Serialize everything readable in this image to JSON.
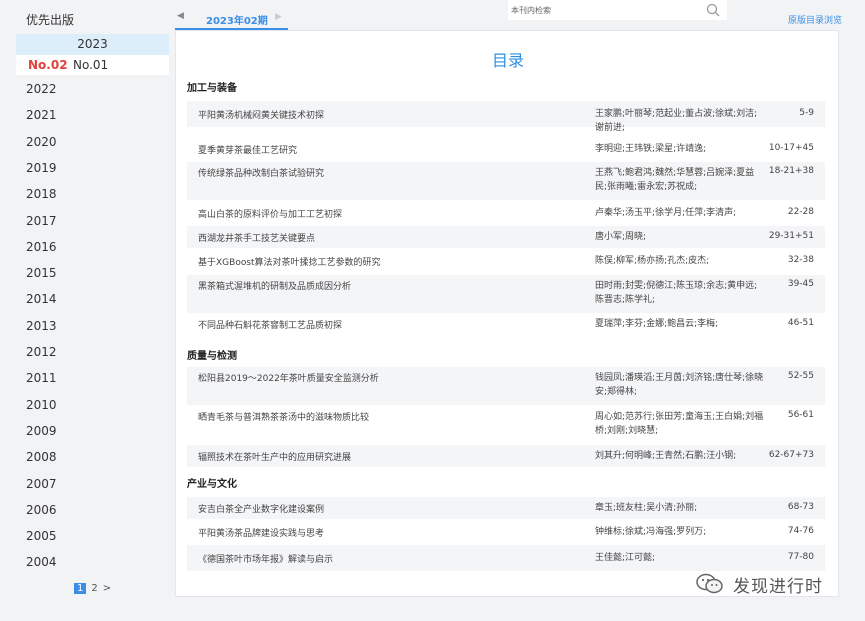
{
  "sidebar": {
    "heading": "优先出版",
    "current_year": "2023",
    "issues": [
      "No.02",
      "No.01"
    ],
    "years": [
      "2022",
      "2021",
      "2020",
      "2019",
      "2018",
      "2017",
      "2016",
      "2015",
      "2014",
      "2013",
      "2012",
      "2011",
      "2010",
      "2009",
      "2008",
      "2007",
      "2006",
      "2005",
      "2004"
    ],
    "pagination": {
      "current": "1",
      "next": "2",
      "arrow": ">"
    }
  },
  "issue_tab": {
    "prev": "◀",
    "label": "2023年02期",
    "next": "▶"
  },
  "search": {
    "placeholder": "本刊内检索",
    "icon": "search-icon"
  },
  "original_link": "原版目录浏览",
  "toc": {
    "title": "目录",
    "sections": [
      {
        "name": "加工与装备",
        "articles": [
          {
            "title": "平阳黄汤机械闷黄关键技术初探",
            "authors": "王家鹏;叶丽琴;范起业;董占波;徐斌;刘洁;谢前进;",
            "pages": "5-9"
          },
          {
            "title": "夏季黄芽茶最佳工艺研究",
            "authors": "李明迎;王玮铁;梁星;许靖逸;",
            "pages": "10-17+45"
          },
          {
            "title": "传统绿茶品种改制白茶试验研究",
            "authors": "王燕飞;鲍君鸿;魏然;华慧蓉;吕婉泽;夏益民;张雨曦;雷永宏;苏祝成;",
            "pages": "18-21+38"
          },
          {
            "title": "高山白茶的原料评价与加工工艺初探",
            "authors": "卢秦华;汤玉平;徐学月;任萍;李清声;",
            "pages": "22-28"
          },
          {
            "title": "西湖龙井茶手工技艺关键要点",
            "authors": "唐小军;周晓;",
            "pages": "29-31+51"
          },
          {
            "title": "基于XGBoost算法对茶叶揉捻工艺参数的研究",
            "authors": "陈俣;柳军;杨亦扬;孔杰;皮杰;",
            "pages": "32-38"
          },
          {
            "title": "黑茶箱式渥堆机的研制及品质成因分析",
            "authors": "田时雨;封雯;倪德江;陈玉琼;余志;黄申远;陈晋志;陈学礼;",
            "pages": "39-45"
          },
          {
            "title": "不同品种石斛花茶窨制工艺品质初探",
            "authors": "夏瑞萍;李芬;金娜;鲍昌云;李梅;",
            "pages": "46-51"
          }
        ]
      },
      {
        "name": "质量与检测",
        "articles": [
          {
            "title": "松阳县2019～2022年茶叶质量安全监测分析",
            "authors": "钱园凤;潘瑛滔;王月茵;刘济铭;唐仕琴;徐晓安;郑得林;",
            "pages": "52-55"
          },
          {
            "title": "晒青毛茶与普洱熟茶茶汤中的滋味物质比较",
            "authors": "周心如;范苏行;张田芳;童海玉;王白娟;刘福桥;刘刚;刘晓慧;",
            "pages": "56-61"
          },
          {
            "title": "辐照技术在茶叶生产中的应用研究进展",
            "authors": "刘其升;何明峰;王青然;石鹏;汪小钢;",
            "pages": "62-67+73"
          }
        ]
      },
      {
        "name": "产业与文化",
        "articles": [
          {
            "title": "安吉白茶全产业数字化建设案例",
            "authors": "章玉;班友柱;吴小清;孙丽;",
            "pages": "68-73"
          },
          {
            "title": "平阳黄汤茶品牌建设实践与思考",
            "authors": "钟维标;徐斌;冯海强;罗列万;",
            "pages": "74-76"
          },
          {
            "title": "《德国茶叶市场年报》解读与启示",
            "authors": "王佳懿;江可懿;",
            "pages": "77-80"
          }
        ]
      }
    ]
  },
  "watermark": {
    "text": "发现进行时",
    "icon": "wechat-icon"
  }
}
